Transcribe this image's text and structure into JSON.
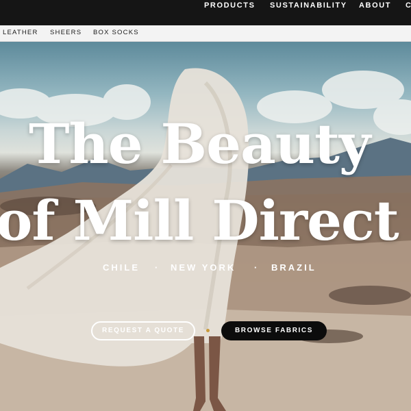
{
  "top_nav": {
    "items": [
      "PRODUCTS",
      "SUSTAINABILITY",
      "ABOUT",
      "C"
    ]
  },
  "sub_nav": {
    "items": [
      "LEATHER",
      "SHEERS",
      "BOX SOCKS"
    ]
  },
  "hero": {
    "headline_line1": "The Beauty",
    "headline_line2": "of Mill Direct",
    "cities": [
      "CHILE",
      "NEW YORK",
      "BRAZIL"
    ],
    "separator": "·",
    "primary_button": "REQUEST A QUOTE",
    "secondary_button": "BROWSE FABRICS",
    "accent_color": "#c99a3a"
  }
}
